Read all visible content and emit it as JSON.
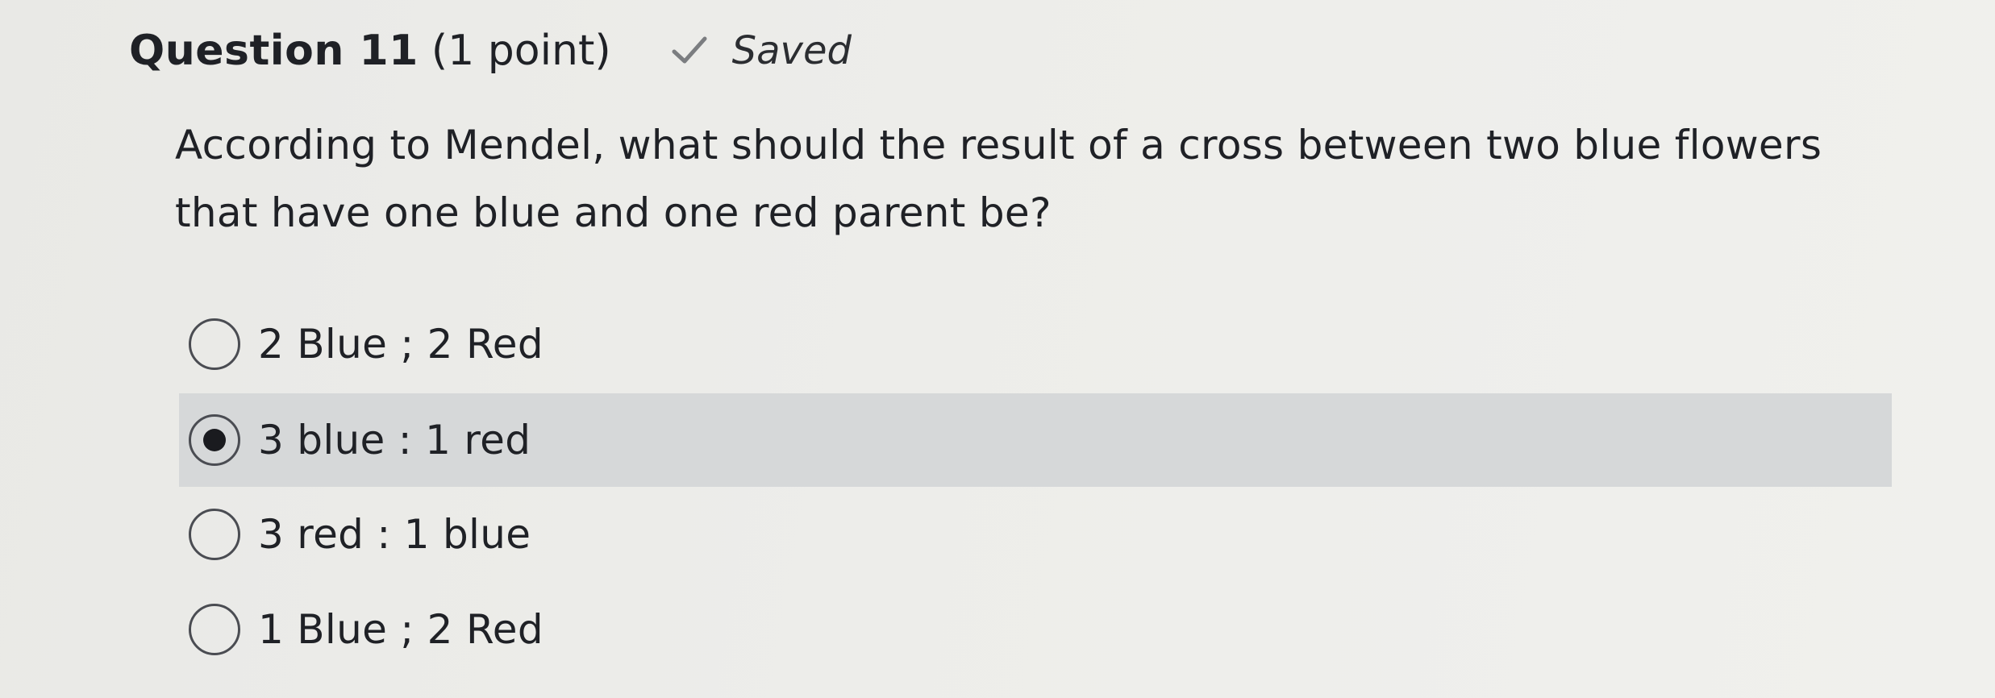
{
  "header": {
    "title": "Question 11",
    "points": "(1 point)",
    "status": "Saved"
  },
  "question": {
    "text": "According to Mendel, what should the result of a cross between two blue flowers that have one blue and one red parent be?"
  },
  "options": [
    {
      "label": "2 Blue ; 2 Red",
      "selected": false
    },
    {
      "label": "3 blue : 1 red",
      "selected": true
    },
    {
      "label": "3 red : 1 blue",
      "selected": false
    },
    {
      "label": "1 Blue ; 2 Red",
      "selected": false
    }
  ],
  "icons": {
    "status": "checkmark-icon",
    "option": "radio-button-icon"
  }
}
